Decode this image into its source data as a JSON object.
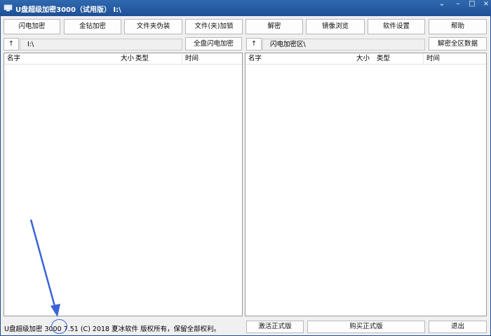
{
  "window": {
    "title": "U盘超级加密3000（试用版）  I:\\",
    "controls": [
      "chevron-down-icon",
      "minimize-icon",
      "maximize-icon",
      "close-icon"
    ]
  },
  "toolbar": {
    "buttons": [
      "闪电加密",
      "金钻加密",
      "文件夹伪装",
      "文件(夹)加锁",
      "解密",
      "镜像浏览",
      "软件设置",
      "帮助"
    ]
  },
  "left_panel": {
    "up_label": "↑",
    "path": "I:\\",
    "action_button": "全盘闪电加密",
    "columns": [
      "名字",
      "大小",
      "类型",
      "时间"
    ]
  },
  "right_panel": {
    "up_label": "↑",
    "path": "闪电加密区\\",
    "action_button": "解密全区数据",
    "columns": [
      "名字",
      "大小",
      "类型",
      "时间"
    ]
  },
  "footer": {
    "status_prefix": "U盘超级加密 3000 ",
    "version": "7.51",
    "status_suffix": " (C) 2018 夏冰软件 版权所有，保留全部权利。",
    "activate_button": "激活正式版",
    "buy_button": "购买正式版",
    "exit_button": "退出"
  },
  "colors": {
    "titlebar": "#1e4f94",
    "annotation": "#3a63d8"
  }
}
